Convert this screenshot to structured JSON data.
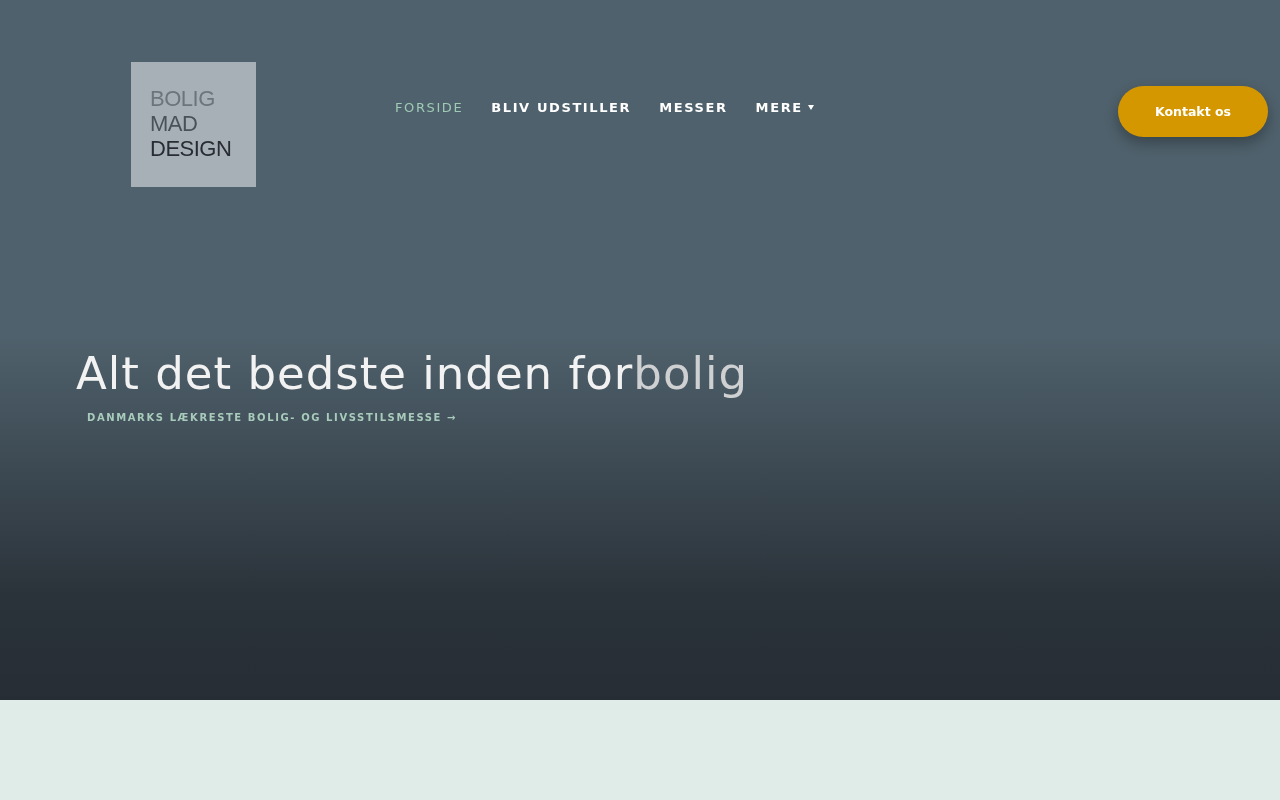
{
  "logo": {
    "lines": [
      "BOLIG",
      "MAD",
      "DESIGN"
    ]
  },
  "nav": [
    {
      "label": "FORSIDE",
      "selected": true,
      "dropdown": false
    },
    {
      "label": "BLIV UDSTILLER",
      "selected": false,
      "dropdown": false
    },
    {
      "label": "MESSER",
      "selected": false,
      "dropdown": false
    },
    {
      "label": "MERE",
      "selected": false,
      "dropdown": true
    }
  ],
  "contact_button": "Kontakt os",
  "hero": {
    "headline": "Alt det bedste inden for",
    "rotating_word": "bolig",
    "subtitle": "DANMARKS LÆKRESTE BOLIG- OG LIVSSTILSMESSE →"
  }
}
